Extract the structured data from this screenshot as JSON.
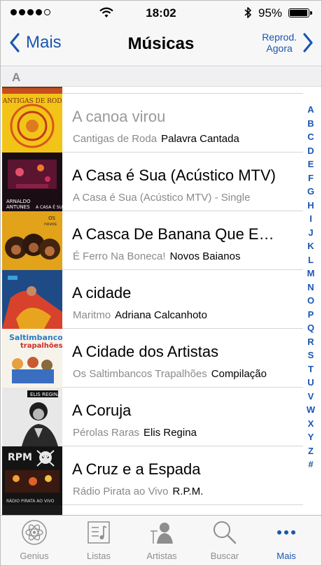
{
  "status": {
    "time": "18:02",
    "battery": "95%"
  },
  "nav": {
    "back_label": "Mais",
    "title": "Músicas",
    "now_playing_line1": "Reprod.",
    "now_playing_line2": "Agora"
  },
  "section": {
    "letter": "A"
  },
  "songs": [
    {
      "title": "A canoa virou",
      "album": "Cantigas de Roda",
      "artist": "Palavra Cantada"
    },
    {
      "title": "A Casa é Sua (Acústico MTV)",
      "album": "A Casa é Sua (Acústico MTV) - Single",
      "artist": ""
    },
    {
      "title": "A Casca De Banana Que Eu Pisei",
      "album": "É Ferro Na Boneca!",
      "artist": "Novos Baianos"
    },
    {
      "title": "A cidade",
      "album": "Maritmo",
      "artist": "Adriana Calcanhoto"
    },
    {
      "title": "A Cidade dos Artistas",
      "album": "Os Saltimbancos Trapalhões",
      "artist": "Compilação"
    },
    {
      "title": "A Coruja",
      "album": "Pérolas Raras",
      "artist": "Elis Regina"
    },
    {
      "title": "A Cruz e a Espada",
      "album": "Rádio Pirata ao Vivo",
      "artist": "R.P.M."
    }
  ],
  "index_letters": [
    "A",
    "B",
    "C",
    "D",
    "E",
    "F",
    "G",
    "H",
    "I",
    "J",
    "K",
    "L",
    "M",
    "N",
    "O",
    "P",
    "Q",
    "R",
    "S",
    "T",
    "U",
    "V",
    "W",
    "X",
    "Y",
    "Z",
    "#"
  ],
  "tabs": [
    {
      "label": "Genius",
      "icon": "genius-atom-icon"
    },
    {
      "label": "Listas",
      "icon": "playlist-icon"
    },
    {
      "label": "Artistas",
      "icon": "artist-icon"
    },
    {
      "label": "Buscar",
      "icon": "search-icon"
    },
    {
      "label": "Mais",
      "icon": "more-icon"
    }
  ],
  "colors": {
    "accent": "#1a56b3",
    "inactive": "#8e8e8e"
  }
}
